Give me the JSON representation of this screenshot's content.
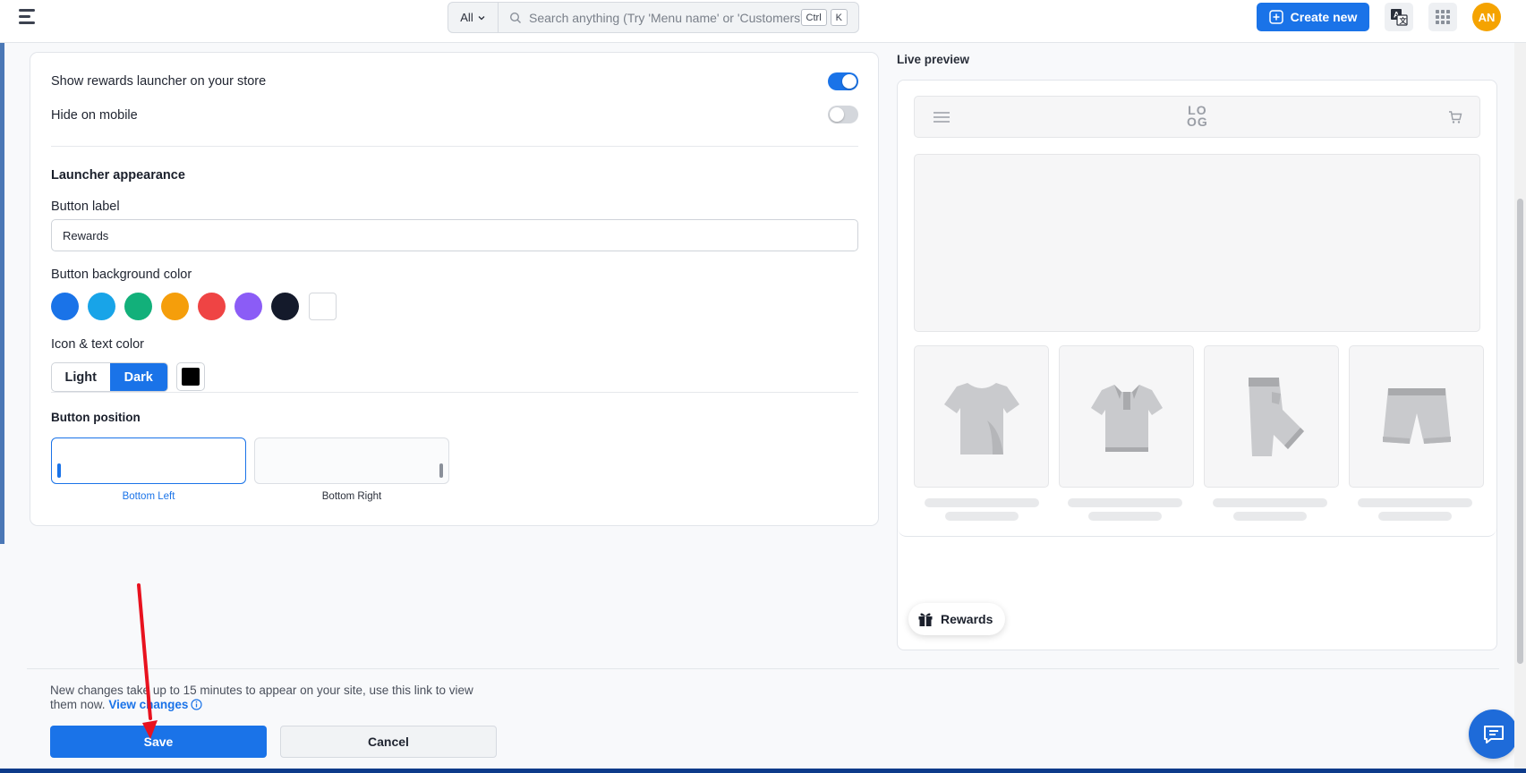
{
  "topbar": {
    "search_scope": "All",
    "search_placeholder": "Search anything (Try 'Menu name' or 'Customers')",
    "kbd_ctrl": "Ctrl",
    "kbd_k": "K",
    "create_label": "Create new",
    "avatar_initials": "AN"
  },
  "settings": {
    "show_launcher_label": "Show rewards launcher on your store",
    "show_launcher_on": true,
    "hide_mobile_label": "Hide on mobile",
    "hide_mobile_on": false,
    "appearance_title": "Launcher appearance",
    "button_label_title": "Button label",
    "button_label_value": "Rewards",
    "bg_color_title": "Button background color",
    "bg_colors": [
      "#1a73e8",
      "#18a4e8",
      "#12b07a",
      "#f59e0b",
      "#ef4444",
      "#8b5cf6",
      "#141a2b",
      "#ffffff"
    ],
    "icon_text_title": "Icon & text color",
    "seg_light": "Light",
    "seg_dark": "Dark",
    "icon_text_color": "#000000",
    "position_title": "Button position",
    "pos_left": "Bottom Left",
    "pos_right": "Bottom Right",
    "selected_position": "Bottom Left"
  },
  "preview": {
    "title": "Live preview",
    "logo_top": "LO",
    "logo_bottom": "OG",
    "rewards_label": "Rewards"
  },
  "footer": {
    "note": "New changes take up to 15 minutes to appear on your site, use this link to view them now.",
    "link": "View changes",
    "save": "Save",
    "cancel": "Cancel"
  },
  "colors": {
    "accent": "#1a73e8",
    "annotation_arrow": "#e8121f"
  }
}
